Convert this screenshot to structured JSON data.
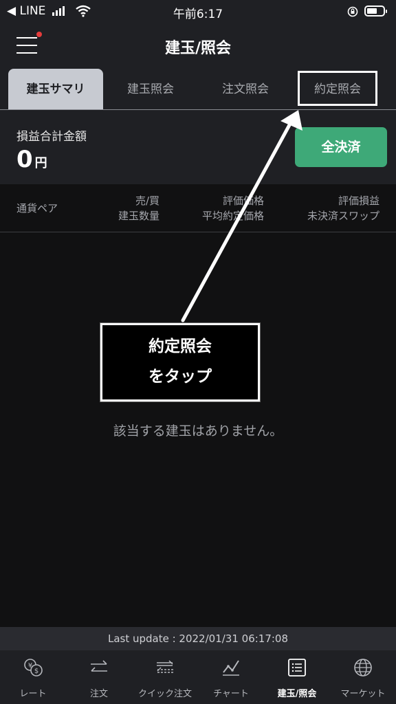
{
  "status_bar": {
    "back_app": "◀ LINE",
    "time": "午前6:17"
  },
  "header": {
    "title": "建玉/照会"
  },
  "tabs": [
    {
      "label": "建玉サマリ",
      "active": true
    },
    {
      "label": "建玉照会",
      "active": false
    },
    {
      "label": "注文照会",
      "active": false
    },
    {
      "label": "約定照会",
      "active": false
    }
  ],
  "summary": {
    "label": "損益合計金額",
    "value": "0",
    "unit": "円",
    "close_all_label": "全決済"
  },
  "columns": {
    "pair": "通貨ペア",
    "side_line1": "売/買",
    "side_line2": "建玉数量",
    "price_line1": "評価価格",
    "price_line2": "平均約定価格",
    "pl_line1": "評価損益",
    "pl_line2": "未決済スワップ"
  },
  "empty_message": "該当する建玉はありません。",
  "annotation": {
    "line1": "約定照会",
    "line2": "をタップ"
  },
  "last_update": "Last update : 2022/01/31 06:17:08",
  "bottom_nav": [
    {
      "label": "レート",
      "icon": "currency-exchange-icon",
      "active": false
    },
    {
      "label": "注文",
      "icon": "order-arrows-icon",
      "active": false
    },
    {
      "label": "クイック注文",
      "icon": "quick-order-icon",
      "active": false
    },
    {
      "label": "チャート",
      "icon": "chart-icon",
      "active": false
    },
    {
      "label": "建玉/照会",
      "icon": "position-list-icon",
      "active": true
    },
    {
      "label": "マーケット",
      "icon": "globe-icon",
      "active": false
    }
  ],
  "colors": {
    "accent_green": "#3ea978",
    "header_bg": "#1f2024",
    "body_bg": "#111112",
    "tab_active_bg": "#c7cad1",
    "notification_dot": "#e53c3c"
  }
}
